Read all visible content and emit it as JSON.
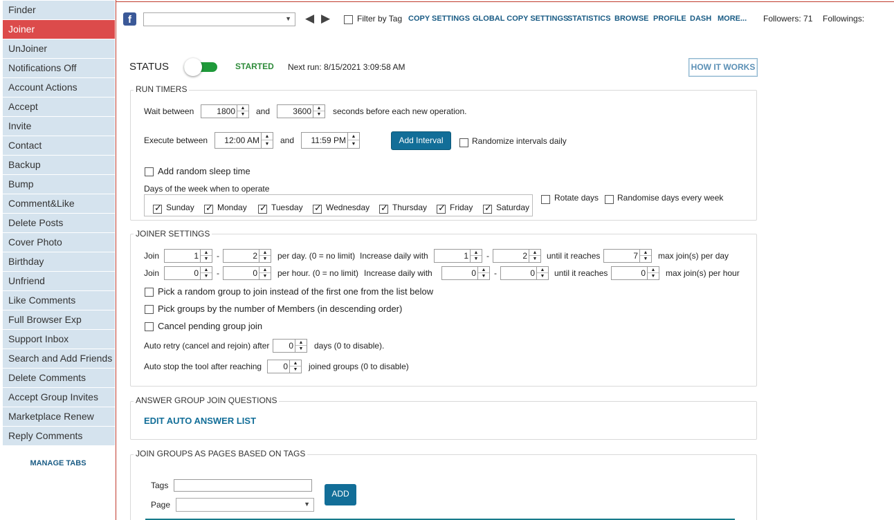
{
  "sidebar": {
    "items": [
      {
        "label": "Finder",
        "active": false
      },
      {
        "label": "Joiner",
        "active": true
      },
      {
        "label": "UnJoiner",
        "active": false
      },
      {
        "label": "Notifications Off",
        "active": false
      },
      {
        "label": "Account Actions",
        "active": false
      },
      {
        "label": "Accept",
        "active": false
      },
      {
        "label": "Invite",
        "active": false
      },
      {
        "label": "Contact",
        "active": false
      },
      {
        "label": "Backup",
        "active": false
      },
      {
        "label": "Bump",
        "active": false
      },
      {
        "label": "Comment&Like",
        "active": false
      },
      {
        "label": "Delete Posts",
        "active": false
      },
      {
        "label": "Cover Photo",
        "active": false
      },
      {
        "label": "Birthday",
        "active": false
      },
      {
        "label": "Unfriend",
        "active": false
      },
      {
        "label": "Like Comments",
        "active": false
      },
      {
        "label": "Full Browser Exp",
        "active": false
      },
      {
        "label": "Support Inbox",
        "active": false
      },
      {
        "label": "Search and Add Friends",
        "active": false
      },
      {
        "label": "Delete Comments",
        "active": false
      },
      {
        "label": "Accept Group Invites",
        "active": false
      },
      {
        "label": "Marketplace Renew",
        "active": false
      },
      {
        "label": "Reply Comments",
        "active": false
      }
    ],
    "manage_tabs": "MANAGE TABS"
  },
  "topbar": {
    "fb_icon_glyph": "f",
    "account_select_value": "",
    "prev_glyph": "◀",
    "next_glyph": "▶",
    "filter_by_tag": "Filter by Tag",
    "links": {
      "copy_settings": "COPY SETTINGS",
      "global_copy_settings": "GLOBAL COPY SETTINGS",
      "statistics": "STATISTICS",
      "browse": "BROWSE",
      "profile": "PROFILE",
      "dash": "DASH",
      "more": "MORE..."
    },
    "followers": "Followers: 71",
    "followings": "Followings:"
  },
  "status": {
    "label": "STATUS",
    "state": "STARTED",
    "toggle_on": true,
    "next_run": "Next run: 8/15/2021 3:09:58 AM",
    "how_it_works": "HOW IT WORKS"
  },
  "run_timers": {
    "title": "RUN TIMERS",
    "wait_between": "Wait between",
    "wait_min": "1800",
    "and1": "and",
    "wait_max": "3600",
    "seconds_text": "seconds before each new operation.",
    "execute_between": "Execute between",
    "exec_start": "12:00 AM",
    "and2": "and",
    "exec_end": "11:59 PM",
    "add_interval": "Add Interval",
    "randomize_intervals": "Randomize intervals daily",
    "add_random_sleep": "Add random sleep time",
    "days_label": "Days of the week when to operate",
    "days": [
      {
        "label": "Sunday",
        "checked": true
      },
      {
        "label": "Monday",
        "checked": true
      },
      {
        "label": "Tuesday",
        "checked": true
      },
      {
        "label": "Wednesday",
        "checked": true
      },
      {
        "label": "Thursday",
        "checked": true
      },
      {
        "label": "Friday",
        "checked": true
      },
      {
        "label": "Saturday",
        "checked": true
      }
    ],
    "rotate_days": "Rotate days",
    "randomise_days": "Randomise days every week"
  },
  "joiner_settings": {
    "title": "JOINER SETTINGS",
    "row1": {
      "join": "Join",
      "min": "1",
      "dash": "-",
      "max": "2",
      "per_text": "per day. (0 = no limit)",
      "increase_text": "Increase daily with",
      "inc_min": "1",
      "dash2": "-",
      "inc_max": "2",
      "until_text": "until it reaches",
      "reach": "7",
      "max_text": "max join(s) per day"
    },
    "row2": {
      "join": "Join",
      "min": "0",
      "dash": "-",
      "max": "0",
      "per_text": "per hour. (0 = no limit)",
      "increase_text": "Increase daily with",
      "inc_min": "0",
      "dash2": "-",
      "inc_max": "0",
      "until_text": "until it reaches",
      "reach": "0",
      "max_text": "max join(s) per hour"
    },
    "pick_random": "Pick a random group to join instead of the first one from the list below",
    "pick_by_members": "Pick groups by the number of Members (in descending order)",
    "cancel_pending": "Cancel pending group join",
    "auto_retry_label": "Auto retry (cancel and rejoin) after",
    "auto_retry_value": "0",
    "auto_retry_suffix": "days (0 to disable).",
    "auto_stop_label": "Auto stop the tool after reaching",
    "auto_stop_value": "0",
    "auto_stop_suffix": "joined groups (0 to disable)"
  },
  "answer_questions": {
    "title": "ANSWER GROUP JOIN QUESTIONS",
    "edit_link": "EDIT AUTO ANSWER LIST"
  },
  "join_as_pages": {
    "title": "JOIN GROUPS AS PAGES BASED ON TAGS",
    "tags_label": "Tags",
    "tags_value": "",
    "page_label": "Page",
    "page_value": "",
    "add_button": "ADD"
  },
  "colors": {
    "active_tab": "#dc4b4b",
    "tab_bg": "#d5e3ee",
    "link": "#1a5c85",
    "button": "#126e98",
    "toggle_on": "#1f9a3a"
  }
}
